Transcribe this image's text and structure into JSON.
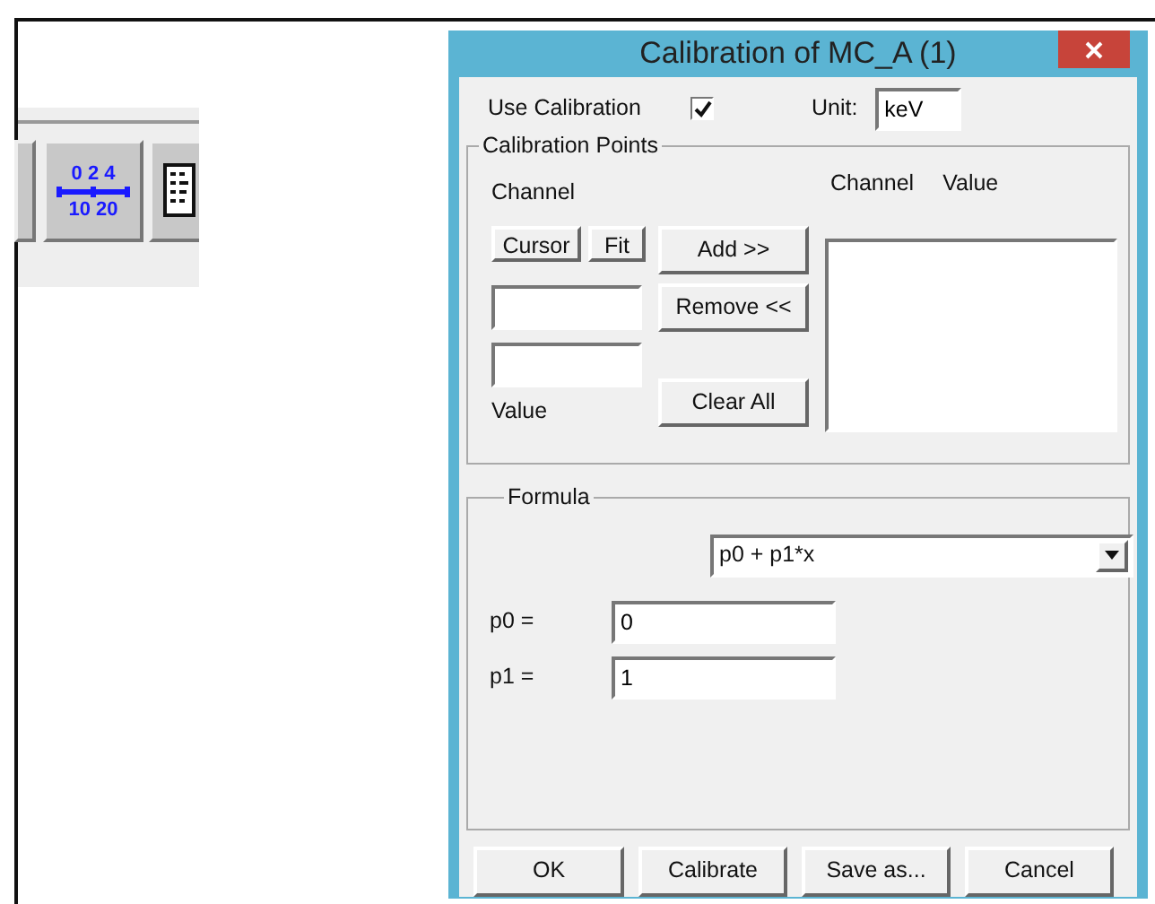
{
  "toolbar": {
    "buttons": [
      {
        "kind": "partial"
      },
      {
        "kind": "ruler",
        "top_scale": "0 2 4",
        "bottom_scale": "10 20"
      },
      {
        "kind": "document"
      }
    ]
  },
  "dialog": {
    "title": "Calibration of MC_A (1)",
    "use_calibration": {
      "label": "Use Calibration",
      "checked": true
    },
    "unit": {
      "label": "Unit:",
      "value": "keV"
    },
    "calibration_points": {
      "legend": "Calibration Points",
      "channel_label": "Channel",
      "value_label": "Value",
      "cursor_button": "Cursor",
      "fit_button": "Fit",
      "add_button": "Add >>",
      "remove_button": "Remove <<",
      "clear_button": "Clear All",
      "list_headers": [
        "Channel",
        "Value"
      ]
    },
    "formula": {
      "legend": "Formula",
      "selected": "p0 + p1*x",
      "parameters": [
        {
          "label": "p0 =",
          "value": "0"
        },
        {
          "label": "p1 =",
          "value": "1"
        }
      ]
    },
    "buttons": [
      "OK",
      "Calibrate",
      "Save as...",
      "Cancel"
    ]
  }
}
